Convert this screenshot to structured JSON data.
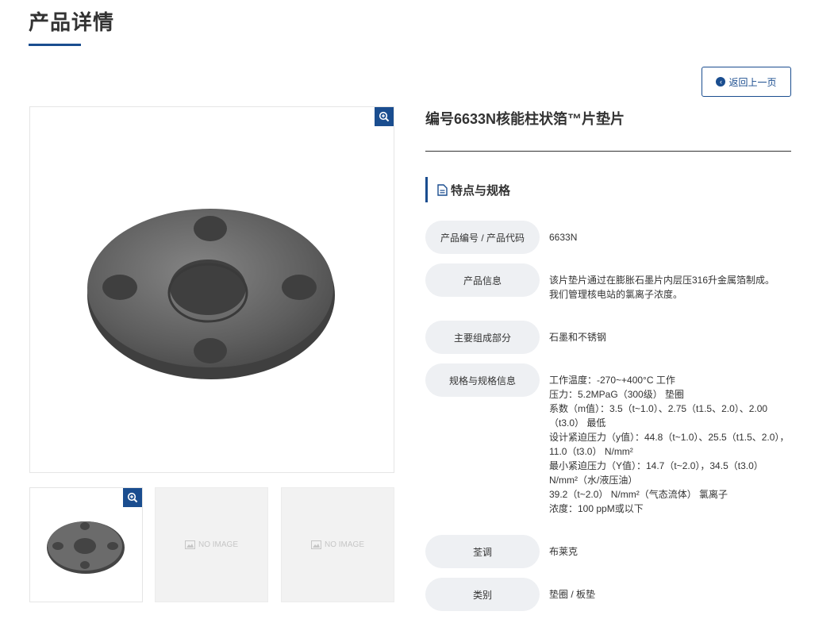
{
  "page": {
    "title": "产品详情"
  },
  "back_button": {
    "label": "返回上一页"
  },
  "gallery": {
    "no_image_label": "NO IMAGE"
  },
  "product": {
    "name": "编号6633N核能柱状箔™片垫片"
  },
  "section": {
    "title": "特点与规格"
  },
  "specs": [
    {
      "label": "产品编号 / 产品代码",
      "value": [
        "6633N"
      ]
    },
    {
      "label": "产品信息",
      "value": [
        "该片垫片通过在膨胀石墨片内层压316升金属箔制成。",
        "我们管理核电站的氯离子浓度。"
      ]
    },
    {
      "label": "主要组成部分",
      "value": [
        "石墨和不锈钢"
      ]
    },
    {
      "label": "规格与规格信息",
      "value": [
        "工作温度：-270~+400°C 工作",
        "压力：5.2MPaG（300级） 垫圈",
        "系数（m值）：3.5（t~1.0）、2.75（t1.5、2.0）、2.00",
        "（t3.0） 最低",
        "设计紧迫压力（y值）：44.8（t~1.0）、25.5（t1.5、2.0），",
        "11.0（t3.0） N/mm²",
        "最小紧迫压力（Y值）：14.7（t~2.0），34.5（t3.0）",
        "N/mm²（水/液压油）",
        "39.2（t~2.0） N/mm²（气态流体） 氯离子",
        "浓度：100 ppM或以下"
      ]
    },
    {
      "label": "荃调",
      "value": [
        "布莱克"
      ]
    },
    {
      "label": "类别",
      "value": [
        "垫圈 / 板垫"
      ]
    }
  ],
  "colors": {
    "accent": "#1a4d8f",
    "label_bg": "#eef0f3",
    "gasket": "#6b6b6b"
  },
  "icons": {
    "zoom": "zoom-in-icon",
    "back": "arrow-left-circle-icon",
    "section": "document-icon",
    "placeholder": "image-placeholder-icon"
  }
}
